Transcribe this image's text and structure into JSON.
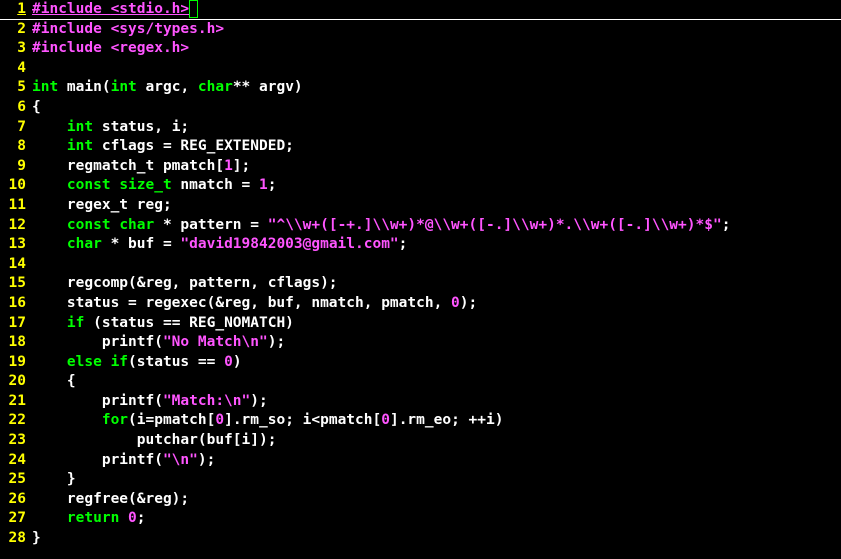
{
  "editor": {
    "language": "c",
    "colorscheme": "default-dark",
    "cursor_line": 1,
    "cursor_col": 19
  },
  "gutter": [
    "1",
    "2",
    "3",
    "4",
    "5",
    "6",
    "7",
    "8",
    "9",
    "10",
    "11",
    "12",
    "13",
    "14",
    "15",
    "16",
    "17",
    "18",
    "19",
    "20",
    "21",
    "22",
    "23",
    "24",
    "25",
    "26",
    "27",
    "28"
  ],
  "tokens": {
    "l1": [
      [
        "pp und",
        "#include "
      ],
      [
        "hdr und",
        "<stdio.h>"
      ]
    ],
    "l2": [
      [
        "pp",
        "#include "
      ],
      [
        "hdr",
        "<sys/types.h>"
      ]
    ],
    "l3": [
      [
        "pp",
        "#include "
      ],
      [
        "hdr",
        "<regex.h>"
      ]
    ],
    "l4": [],
    "l5": [
      [
        "kw",
        "int"
      ],
      [
        "id",
        " main("
      ],
      [
        "kw",
        "int"
      ],
      [
        "id",
        " argc, "
      ],
      [
        "kw",
        "char"
      ],
      [
        "id",
        "** argv)"
      ]
    ],
    "l6": [
      [
        "id",
        "{"
      ]
    ],
    "l7": [
      [
        "id",
        "    "
      ],
      [
        "kw",
        "int"
      ],
      [
        "id",
        " status, i;"
      ]
    ],
    "l8": [
      [
        "id",
        "    "
      ],
      [
        "kw",
        "int"
      ],
      [
        "id",
        " cflags = REG_EXTENDED;"
      ]
    ],
    "l9": [
      [
        "id",
        "    regmatch_t pmatch["
      ],
      [
        "num",
        "1"
      ],
      [
        "id",
        "];"
      ]
    ],
    "l10": [
      [
        "id",
        "    "
      ],
      [
        "kw",
        "const"
      ],
      [
        "id",
        " "
      ],
      [
        "kw",
        "size_t"
      ],
      [
        "id",
        " nmatch = "
      ],
      [
        "num",
        "1"
      ],
      [
        "id",
        ";"
      ]
    ],
    "l11": [
      [
        "id",
        "    regex_t reg;"
      ]
    ],
    "l12": [
      [
        "id",
        "    "
      ],
      [
        "kw",
        "const"
      ],
      [
        "id",
        " "
      ],
      [
        "kw",
        "char"
      ],
      [
        "id",
        " * pattern = "
      ],
      [
        "str",
        "\"^\\\\w+([-+.]\\\\w+)*@\\\\w+([-.]\\\\w+)*.\\\\w+([-.]\\\\w+)*$\""
      ],
      [
        "id",
        ";"
      ]
    ],
    "l13": [
      [
        "id",
        "    "
      ],
      [
        "kw",
        "char"
      ],
      [
        "id",
        " * buf = "
      ],
      [
        "str",
        "\"david19842003@gmail.com\""
      ],
      [
        "id",
        ";"
      ]
    ],
    "l14": [],
    "l15": [
      [
        "id",
        "    regcomp(&reg, pattern, cflags);"
      ]
    ],
    "l16": [
      [
        "id",
        "    status = regexec(&reg, buf, nmatch, pmatch, "
      ],
      [
        "num",
        "0"
      ],
      [
        "id",
        ");"
      ]
    ],
    "l17": [
      [
        "id",
        "    "
      ],
      [
        "kw",
        "if"
      ],
      [
        "id",
        " (status == REG_NOMATCH)"
      ]
    ],
    "l18": [
      [
        "id",
        "        printf("
      ],
      [
        "str",
        "\"No Match\\n\""
      ],
      [
        "id",
        ");"
      ]
    ],
    "l19": [
      [
        "id",
        "    "
      ],
      [
        "kw",
        "else"
      ],
      [
        "id",
        " "
      ],
      [
        "kw",
        "if"
      ],
      [
        "id",
        "(status == "
      ],
      [
        "num",
        "0"
      ],
      [
        "id",
        ")"
      ]
    ],
    "l20": [
      [
        "id",
        "    {"
      ]
    ],
    "l21": [
      [
        "id",
        "        printf("
      ],
      [
        "str",
        "\"Match:\\n\""
      ],
      [
        "id",
        ");"
      ]
    ],
    "l22": [
      [
        "id",
        "        "
      ],
      [
        "kw",
        "for"
      ],
      [
        "id",
        "(i=pmatch["
      ],
      [
        "num",
        "0"
      ],
      [
        "id",
        "].rm_so; i<pmatch["
      ],
      [
        "num",
        "0"
      ],
      [
        "id",
        "].rm_eo; ++i)"
      ]
    ],
    "l23": [
      [
        "id",
        "            putchar(buf[i]);"
      ]
    ],
    "l24": [
      [
        "id",
        "        printf("
      ],
      [
        "str",
        "\"\\n\""
      ],
      [
        "id",
        ");"
      ]
    ],
    "l25": [
      [
        "id",
        "    }"
      ]
    ],
    "l26": [
      [
        "id",
        "    regfree(&reg);"
      ]
    ],
    "l27": [
      [
        "id",
        "    "
      ],
      [
        "kw",
        "return"
      ],
      [
        "id",
        " "
      ],
      [
        "num",
        "0"
      ],
      [
        "id",
        ";"
      ]
    ],
    "l28": [
      [
        "id",
        "}"
      ]
    ]
  },
  "chart_data": null
}
